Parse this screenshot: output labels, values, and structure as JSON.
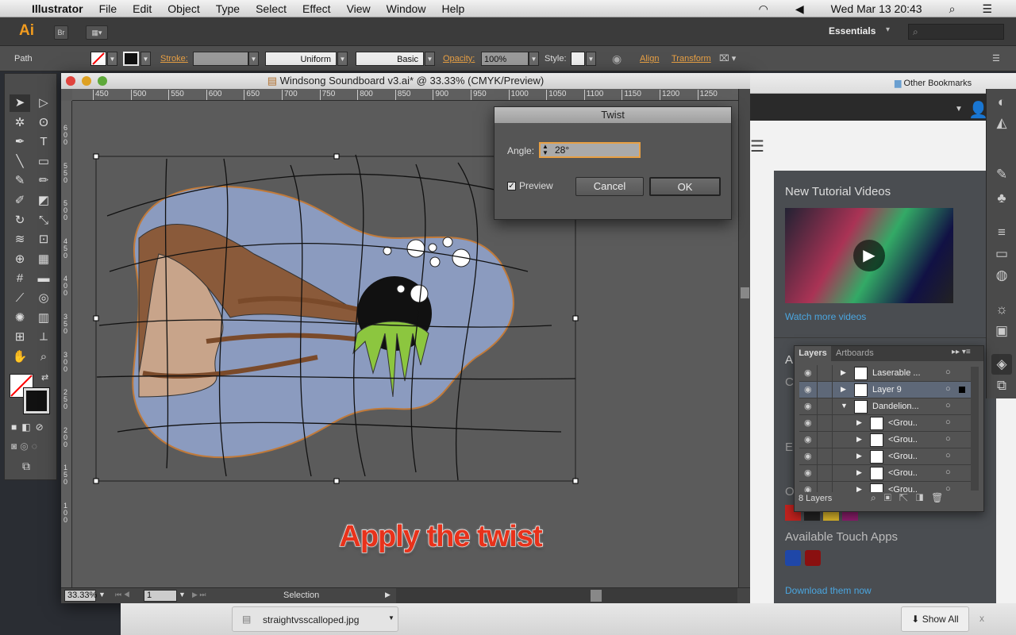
{
  "menubar": {
    "app": "Illustrator",
    "items": [
      "File",
      "Edit",
      "Object",
      "Type",
      "Select",
      "Effect",
      "View",
      "Window",
      "Help"
    ],
    "clock": "Wed Mar 13  20:43"
  },
  "appbar": {
    "logo": "Ai",
    "bridge": "Br",
    "workspace": "Essentials",
    "search_placeholder": ""
  },
  "control": {
    "selection_type": "Path",
    "stroke_label": "Stroke:",
    "stroke_profile": "Uniform",
    "brush": "Basic",
    "opacity_label": "Opacity:",
    "opacity": "100%",
    "style_label": "Style:",
    "align": "Align",
    "transform": "Transform"
  },
  "tools": [
    "selection",
    "direct-selection",
    "magic-wand",
    "lasso",
    "pen",
    "type",
    "line",
    "rectangle",
    "paintbrush",
    "pencil",
    "blob-brush",
    "eraser",
    "rotate",
    "scale",
    "width",
    "free-transform",
    "shape-builder",
    "perspective-grid",
    "mesh",
    "gradient",
    "eyedropper",
    "blend",
    "symbol-sprayer",
    "column-graph",
    "artboard",
    "slice",
    "hand",
    "zoom"
  ],
  "document": {
    "title": "Windsong Soundboard v3.ai* @ 33.33% (CMYK/Preview)",
    "ruler_top": [
      "450",
      "500",
      "550",
      "600",
      "650",
      "700",
      "750",
      "800",
      "850",
      "900",
      "950",
      "1000",
      "1050",
      "1100",
      "1150",
      "1200",
      "1250"
    ],
    "ruler_left": [
      "600",
      "550",
      "500",
      "450",
      "400",
      "350",
      "300",
      "250",
      "200",
      "150",
      "100"
    ],
    "zoom": "33.33%",
    "artboard": "1",
    "status": "Selection"
  },
  "dialog": {
    "title": "Twist",
    "angle_label": "Angle:",
    "angle": "28°",
    "preview_label": "Preview",
    "preview_checked": true,
    "cancel": "Cancel",
    "ok": "OK"
  },
  "browser": {
    "bookmarks": "Other Bookmarks",
    "cc": {
      "tutorials_title": "New Tutorial Videos",
      "watch": "Watch more videos",
      "touch_title": "Available Touch Apps",
      "download": "Download them now",
      "letters": [
        "A",
        "C",
        "E",
        "O"
      ]
    }
  },
  "layers": {
    "tabs": [
      "Layers",
      "Artboards"
    ],
    "rows": [
      {
        "name": "Laserable ...",
        "indent": 0,
        "expanded": false,
        "selected": false
      },
      {
        "name": "Layer 9",
        "indent": 0,
        "expanded": false,
        "selected": true
      },
      {
        "name": "Dandelion...",
        "indent": 0,
        "expanded": true,
        "selected": false
      },
      {
        "name": "<Grou..",
        "indent": 1,
        "expanded": false,
        "selected": false
      },
      {
        "name": "<Grou..",
        "indent": 1,
        "expanded": false,
        "selected": false
      },
      {
        "name": "<Grou..",
        "indent": 1,
        "expanded": false,
        "selected": false
      },
      {
        "name": "<Grou..",
        "indent": 1,
        "expanded": false,
        "selected": false
      },
      {
        "name": "<Grou..",
        "indent": 1,
        "expanded": false,
        "selected": false
      }
    ],
    "count": "8 Layers"
  },
  "download": {
    "file": "straightvsscalloped.jpg",
    "show_all": "Show All",
    "close": "x"
  },
  "caption": "Apply the twist",
  "colors": {
    "accent": "#f29c1f",
    "link": "#4aa6e0",
    "artwork_blue": "#8b9bbf",
    "hair": "#8a5a3a",
    "skin": "#c8a48a",
    "dandelion_green": "#8cc63f",
    "caption": "#e8321b"
  }
}
